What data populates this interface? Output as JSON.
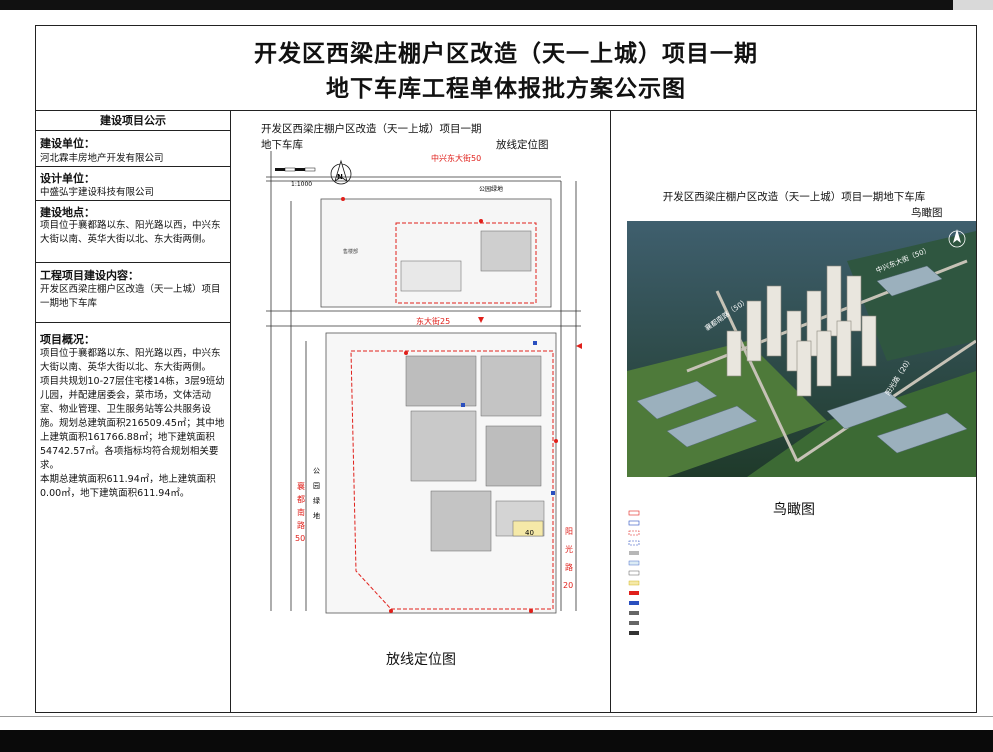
{
  "title": {
    "line1": "开发区西梁庄棚户区改造（天一上城）项目一期",
    "line2": "地下车库工程单体报批方案公示图"
  },
  "left_panel": {
    "header": "建设项目公示",
    "construction_unit_label": "建设单位：",
    "construction_unit": "河北霖丰房地产开发有限公司",
    "design_unit_label": "设计单位：",
    "design_unit": "中盛弘宇建设科技有限公司",
    "site_label": "建设地点：",
    "site": "项目位于襄都路以东、阳光路以西，中兴东大街以南、英华大街以北、东大街两侧。",
    "content_label": "工程项目建设内容：",
    "content": "开发区西梁庄棚户区改造（天一上城）项目一期地下车库",
    "overview_label": "项目概况：",
    "overview_p1": "项目位于襄都路以东、阳光路以西，中兴东大街以南、英华大街以北、东大街两侧。",
    "overview_p2": "项目共规划10-27层住宅楼14栋，3层9班幼儿园，并配建居委会，菜市场，文体活动室、物业管理、卫生服务站等公共服务设施。规划总建筑面积216509.45㎡；其中地上建筑面积161766.88㎡；地下建筑面积54742.57㎡。各项指标均符合规划相关要求。",
    "overview_p3": "本期总建筑面积611.94㎡，地上建筑面积0.00㎡，地下建筑面积611.94㎡。"
  },
  "site_plan": {
    "title_line1": "开发区西梁庄棚户区改造（天一上城）项目一期",
    "title_line2": "地下车库",
    "title_right": "放线定位图",
    "caption": "放线定位图",
    "scale": "1:1000",
    "north": "N",
    "streets": {
      "north": "中兴东大街50",
      "middle": "东大街25",
      "west_1": "襄",
      "west_2": "都",
      "west_3": "南",
      "west_4": "路",
      "west_5": "50",
      "east_1": "阳",
      "east_2": "光",
      "east_3": "路",
      "east_4": "20"
    },
    "labels": {
      "park_north": "公园绿地",
      "park_west_1": "公",
      "park_west_2": "园",
      "park_west_3": "绿",
      "park_west_4": "地",
      "showroom": "售楼部",
      "garage_no": "40"
    }
  },
  "aerial": {
    "title_line1": "开发区西梁庄棚户区改造（天一上城）项目一期地下车库",
    "title_line2": "鸟瞰图",
    "caption": "鸟瞰图",
    "road_labels": [
      "中兴东大街（50）",
      "襄都南路（50）",
      "阳光路（20）"
    ]
  },
  "colors": {
    "red": "#e0201b",
    "blue": "#2a4fbf",
    "gray_block": "#b7b7b7",
    "frame": "#222222"
  }
}
